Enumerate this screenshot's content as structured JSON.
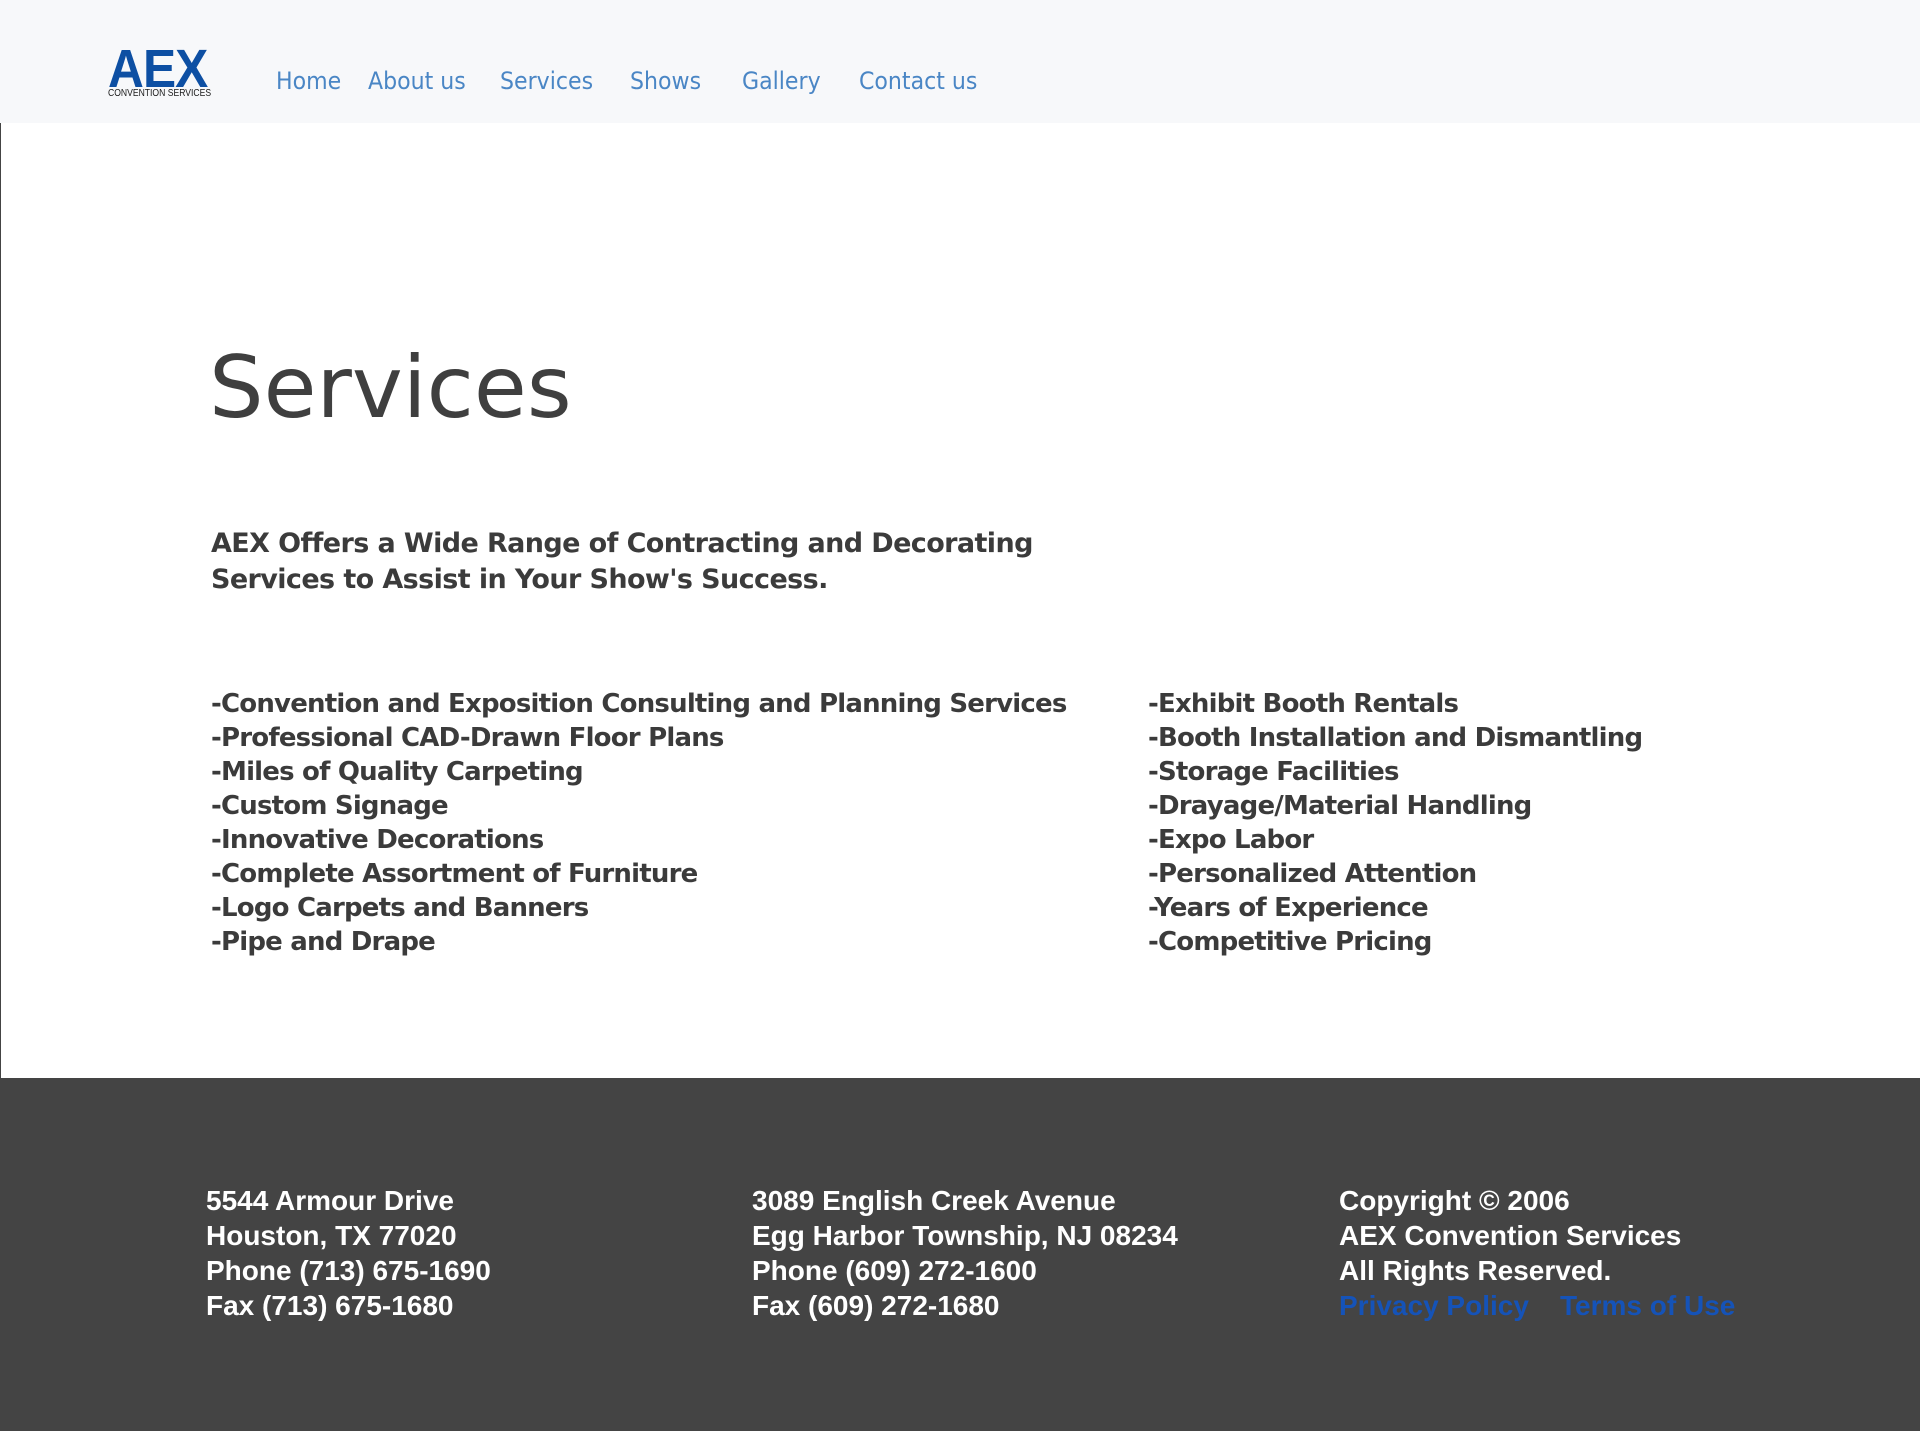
{
  "header": {
    "logo": {
      "main": "AEX",
      "sub": "CONVENTION SERVICES"
    },
    "nav": [
      {
        "label": "Home"
      },
      {
        "label": "About us"
      },
      {
        "label": "Services"
      },
      {
        "label": "Shows"
      },
      {
        "label": "Gallery"
      },
      {
        "label": "Contact us"
      }
    ]
  },
  "main": {
    "title": "Services",
    "intro": "AEX Offers a Wide Range of Contracting and Decorating Services to Assist in Your Show's Success.",
    "services_left": [
      "-Convention and Exposition Consulting and Planning Services",
      "-Professional CAD-Drawn Floor Plans",
      "-Miles of Quality Carpeting",
      "-Custom Signage",
      "-Innovative Decorations",
      "-Complete Assortment of Furniture",
      "-Logo Carpets and Banners",
      "-Pipe and Drape"
    ],
    "services_right": [
      "-Exhibit Booth Rentals",
      "-Booth Installation and Dismantling",
      "-Storage Facilities",
      "-Drayage/Material Handling",
      "-Expo Labor",
      "-Personalized Attention",
      "-Years of Experience",
      "-Competitive Pricing"
    ]
  },
  "footer": {
    "houston": {
      "street": "5544 Armour Drive",
      "city": "Houston, TX 77020",
      "phone": "Phone (713) 675-1690",
      "fax": "Fax (713) 675-1680"
    },
    "nj": {
      "street": "3089 English Creek Avenue",
      "city": "Egg Harbor Township, NJ 08234",
      "phone": "Phone (609) 272-1600",
      "fax": "Fax (609) 272-1680"
    },
    "legal": {
      "copyright": "Copyright © 2006",
      "company": "AEX Convention Services",
      "rights": "All Rights Reserved.",
      "privacy": "Privacy Policy",
      "terms": "Terms of Use"
    }
  },
  "colors": {
    "nav_link": "#4a86c5",
    "logo": "#0d4fa3",
    "footer_bg": "#444444",
    "footer_link": "#1553b8",
    "text_dark": "#3b3b3b"
  }
}
